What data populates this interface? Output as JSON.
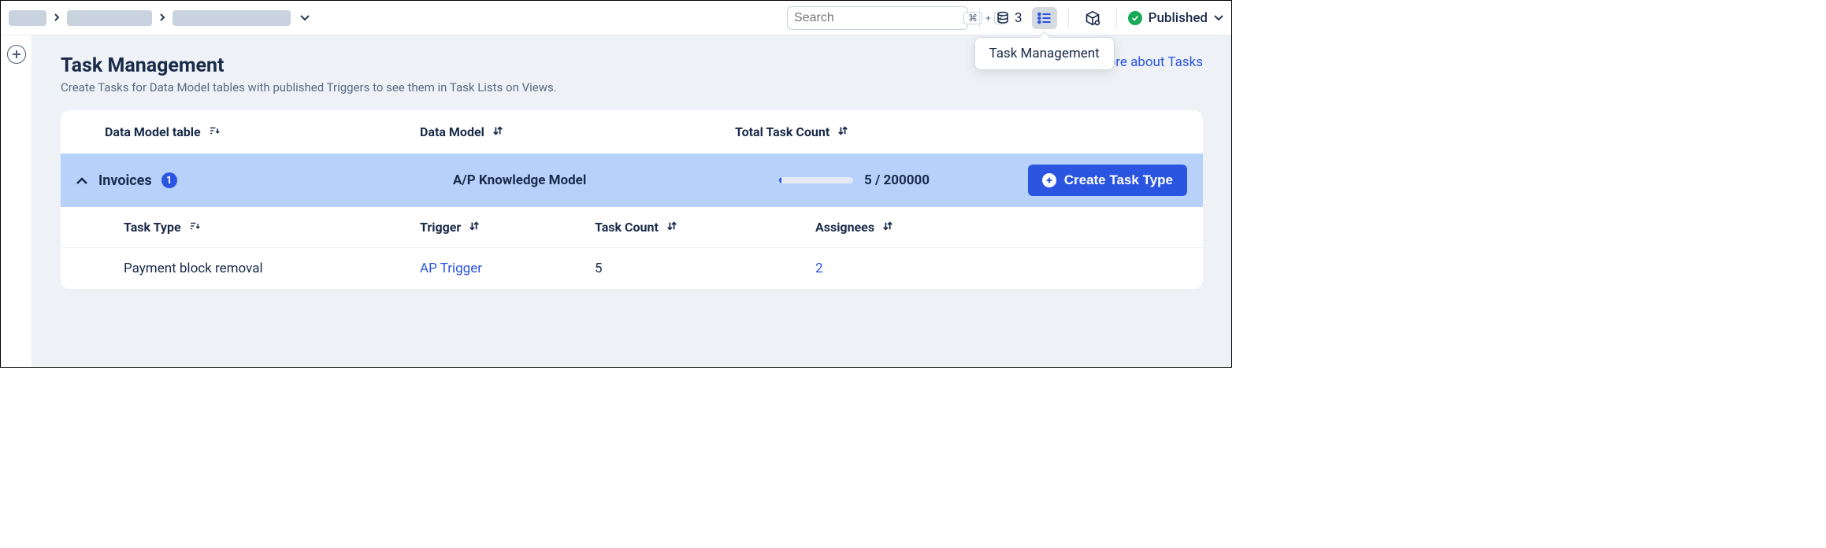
{
  "topbar": {
    "search_placeholder": "Search",
    "search_shortcut_cmd": "⌘",
    "search_shortcut_plus": "+",
    "search_shortcut_slash": "/",
    "db_count": "3",
    "task_tooltip": "Task Management",
    "publish_status": "Published"
  },
  "page": {
    "title": "Task Management",
    "subtitle": "Create Tasks for Data Model tables with published Triggers to see them in Task Lists on Views.",
    "learn_link": "Learn more about Tasks"
  },
  "outer_headers": {
    "col_a": "Data Model table",
    "col_b": "Data Model",
    "col_c": "Total Task Count"
  },
  "group": {
    "name": "Invoices",
    "badge": "1",
    "data_model": "A/P Knowledge Model",
    "task_count": "5 / 200000",
    "create_btn": "Create Task Type"
  },
  "inner_headers": {
    "col_a": "Task Type",
    "col_b": "Trigger",
    "col_c": "Task Count",
    "col_d": "Assignees"
  },
  "rows": [
    {
      "task_type": "Payment block removal",
      "trigger": "AP Trigger",
      "task_count": "5",
      "assignees": "2"
    }
  ]
}
